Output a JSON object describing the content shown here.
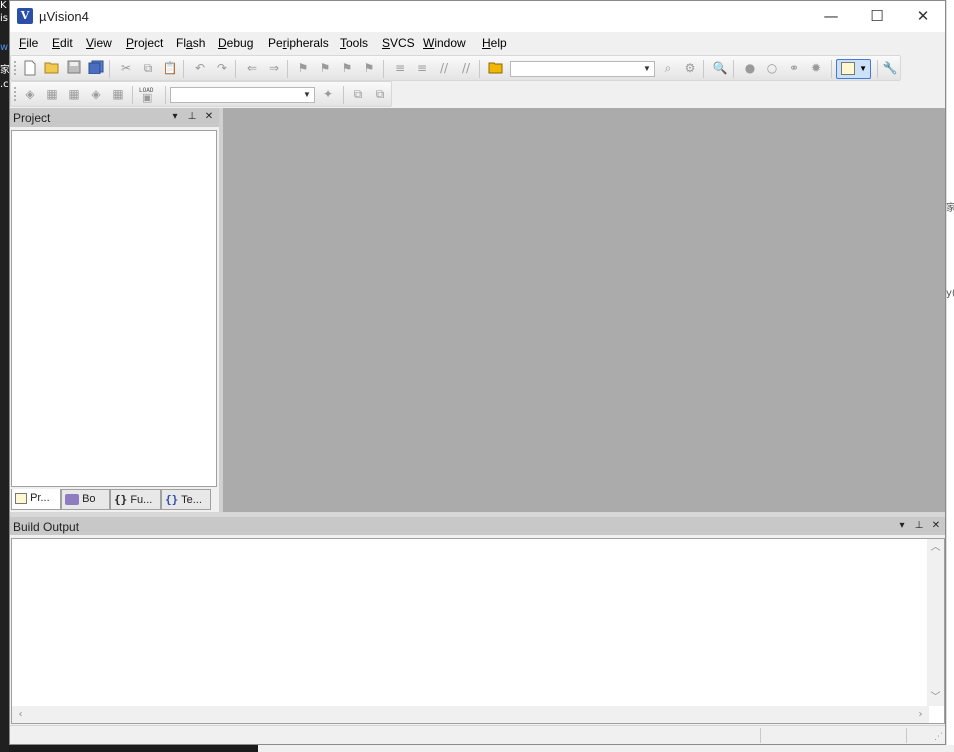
{
  "window": {
    "title": "µVision4",
    "app_icon_glyph": "V",
    "controls": {
      "minimize": "—",
      "maximize": "☐",
      "close": "✕"
    }
  },
  "menubar": [
    {
      "pre": "",
      "u": "F",
      "post": "ile"
    },
    {
      "pre": "",
      "u": "E",
      "post": "dit"
    },
    {
      "pre": "",
      "u": "V",
      "post": "iew"
    },
    {
      "pre": "",
      "u": "P",
      "post": "roject"
    },
    {
      "pre": "Fl",
      "u": "a",
      "post": "sh"
    },
    {
      "pre": "",
      "u": "D",
      "post": "ebug"
    },
    {
      "pre": "Pe",
      "u": "r",
      "post": "ipherals"
    },
    {
      "pre": "",
      "u": "T",
      "post": "ools"
    },
    {
      "pre": "",
      "u": "S",
      "post": "VCS"
    },
    {
      "pre": "",
      "u": "W",
      "post": "indow"
    },
    {
      "pre": "",
      "u": "H",
      "post": "elp"
    }
  ],
  "toolbar1": {
    "icons": [
      "new-file-icon",
      "open-folder-icon",
      "save-icon",
      "save-all-icon",
      "cut-icon",
      "copy-icon",
      "paste-icon",
      "undo-icon",
      "redo-icon",
      "nav-back-icon",
      "nav-forward-icon",
      "bookmark-icon",
      "prev-bookmark-icon",
      "next-bookmark-icon",
      "clear-bookmarks-icon",
      "indent-icon",
      "unindent-icon",
      "comment-icon",
      "uncomment-icon",
      "find-in-files-icon"
    ],
    "find_combo_value": "",
    "icons2": [
      "incremental-find-icon",
      "debug-find-icon",
      "zoom-find-icon",
      "breakpoint-icon",
      "disabled-breakpoint-icon",
      "disable-all-breakpoints-icon",
      "kill-all-breakpoints-icon",
      "window-select-icon",
      "configure-icon"
    ]
  },
  "toolbar2": {
    "icons": [
      "translate-icon",
      "build-icon",
      "rebuild-icon",
      "batch-build-icon",
      "stop-build-icon",
      "download-icon"
    ],
    "load_label": "LOAD",
    "target_combo_value": "",
    "icons2": [
      "target-options-icon",
      "manage-components-icon",
      "manage-project-items-icon"
    ]
  },
  "project_panel": {
    "title": "Project",
    "tabs": [
      {
        "label": "Pr...",
        "icon": "project-tab-icon"
      },
      {
        "label": "Bo",
        "icon": "books-tab-icon"
      },
      {
        "label": "Fu...",
        "icon": "functions-tab-icon",
        "glyph": "{}"
      },
      {
        "label": "Te...",
        "icon": "templates-tab-icon",
        "glyph": "{}"
      }
    ]
  },
  "build_panel": {
    "title": "Build Output"
  },
  "panel_controls": {
    "dropdown": "▾",
    "pin": "⊥",
    "close": "✕"
  },
  "scroll_glyphs": {
    "up": "︿",
    "down": "﹀",
    "left": "‹",
    "right": "›"
  },
  "desktop_fragments": {
    "left": [
      "K",
      "is",
      "w",
      "家",
      ".c"
    ],
    "right": [
      "家",
      "y("
    ]
  }
}
